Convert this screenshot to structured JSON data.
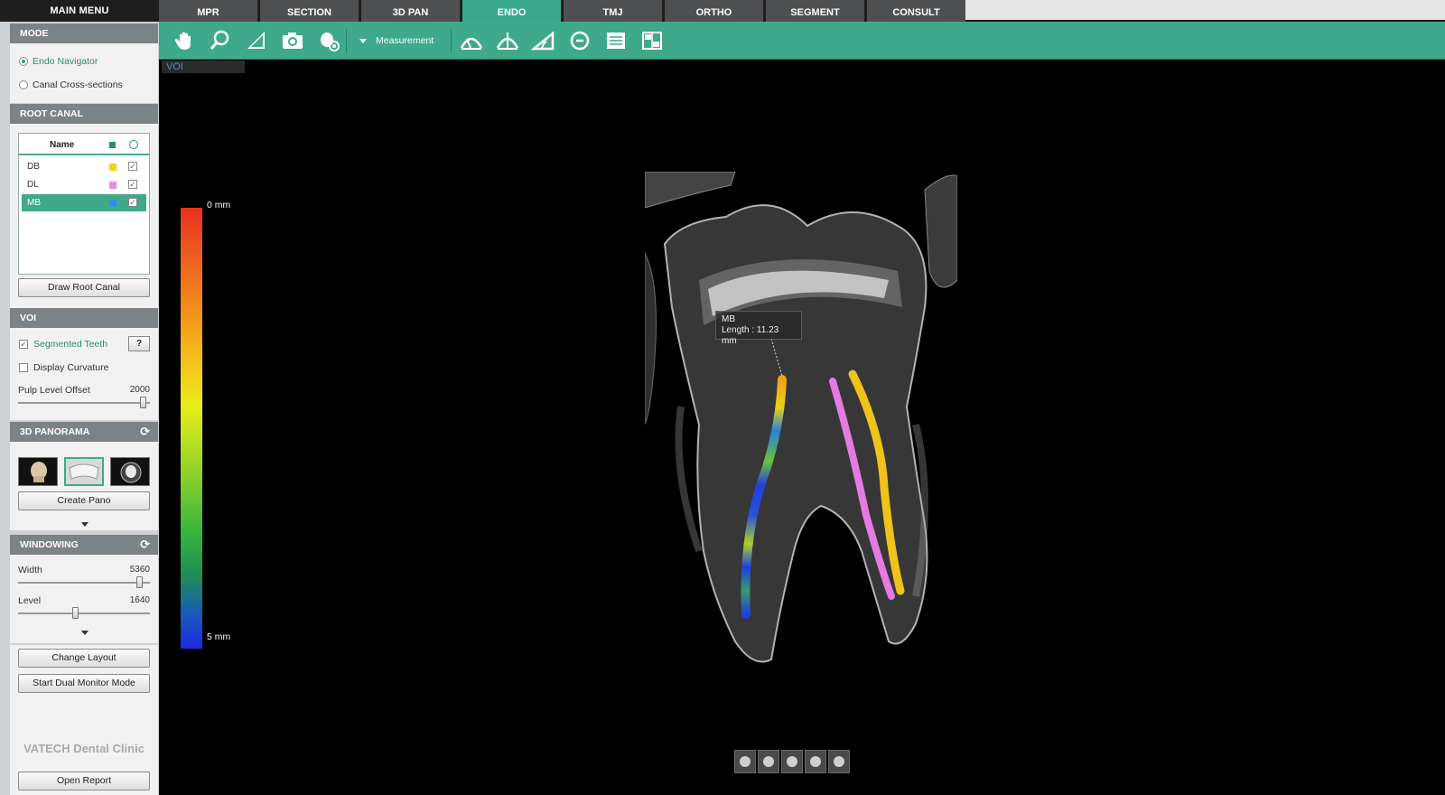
{
  "left_panel": {
    "main_menu": "MAIN MENU",
    "mode": {
      "header": "MODE",
      "options": [
        "Endo Navigator",
        "Canal Cross-sections"
      ],
      "selected": "Endo Navigator"
    },
    "root_canal": {
      "header": "ROOT CANAL",
      "table_header": "Name",
      "rows": [
        {
          "name": "DB",
          "color": "#f2d21a",
          "visible": true
        },
        {
          "name": "DL",
          "color": "#e68be6",
          "visible": true
        },
        {
          "name": "MB",
          "color": "#2f8fe0",
          "visible": true
        }
      ],
      "selected": "MB",
      "draw_button": "Draw Root Canal"
    },
    "voi": {
      "header": "VOI",
      "segmented_teeth": "Segmented Teeth",
      "segmented_checked": true,
      "help": "?",
      "display_curvature": "Display Curvature",
      "curvature_checked": false,
      "pulp_label": "Pulp Level Offset",
      "pulp_value": "2000",
      "pulp_fraction": 0.97
    },
    "panorama": {
      "header": "3D PANORAMA",
      "create_button": "Create Pano",
      "selected_thumb": 1
    },
    "windowing": {
      "header": "WINDOWING",
      "width_label": "Width",
      "width_value": "5360",
      "width_fraction": 0.94,
      "level_label": "Level",
      "level_value": "1640",
      "level_fraction": 0.43
    },
    "change_layout": "Change Layout",
    "dual_monitor": "Start Dual Monitor Mode",
    "brand": "VATECH Dental Clinic",
    "open_report": "Open Report"
  },
  "tabs": [
    "MPR",
    "SECTION",
    "3D PAN",
    "ENDO",
    "TMJ",
    "ORTHO",
    "SEGMENT",
    "CONSULT"
  ],
  "active_tab": "ENDO",
  "toolbar": {
    "measurement_label": "Measurement",
    "tools": [
      "hand-icon",
      "zoom-icon",
      "contrast-icon",
      "camera-icon",
      "face-cursor-icon",
      "canal-view-1-icon",
      "canal-view-2-icon",
      "angle-icon",
      "rotate-icon",
      "report-icon",
      "layout-icon"
    ]
  },
  "viewport": {
    "voi_tag": "VOI",
    "scale_top": "0 mm",
    "scale_bottom": "5 mm",
    "annotation_name": "MB",
    "annotation_length": "Length : 11.23 mm",
    "view_buttons": [
      "view-anterior-icon",
      "view-left-icon",
      "view-right-icon",
      "view-posterior-icon",
      "view-reset-icon"
    ]
  }
}
